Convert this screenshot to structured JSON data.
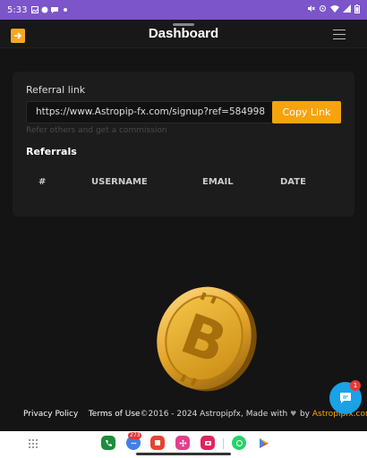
{
  "status_bar": {
    "time": "5:33",
    "colors": {
      "background": "#7B55C9"
    }
  },
  "header": {
    "title": "Dashboard",
    "back_icon": "arrow-right-icon",
    "menu_icon": "hamburger-menu-icon"
  },
  "referral": {
    "label": "Referral link",
    "link_value": "https://www.Astropip-fx.com/signup?ref=584998",
    "copy_label": "Copy Link",
    "hint": "Refer others and get a commission"
  },
  "referrals_table": {
    "heading": "Referrals",
    "columns": [
      "#",
      "USERNAME",
      "EMAIL",
      "DATE"
    ],
    "rows": []
  },
  "footer": {
    "privacy": "Privacy Policy",
    "terms": "Terms of Use",
    "copyright": "©2016 - 2024 Astropipfx, Made with",
    "by": "by",
    "brand": "Astropipfx.com"
  },
  "chat": {
    "icon": "chat-icon",
    "badge": "1"
  },
  "dock": {
    "badge": "273",
    "apps": [
      "phone-app",
      "messages-app",
      "notes-app",
      "flower-app",
      "camera-app",
      "whatsapp-app",
      "play-store-app"
    ]
  },
  "colors": {
    "accent": "#F7A30D",
    "card": "#1c1c1c",
    "page_background": "#141414",
    "chat": "#1AA1E6"
  }
}
